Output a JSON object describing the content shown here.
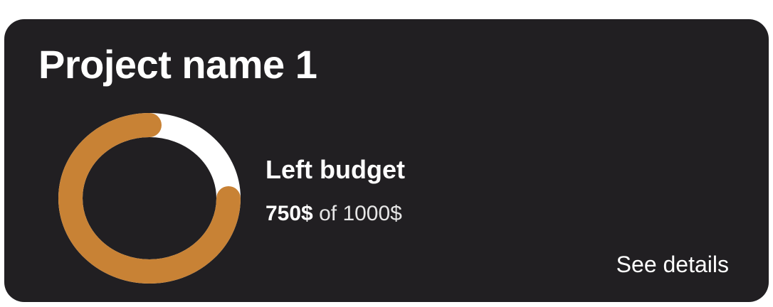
{
  "project": {
    "name": "Project name 1"
  },
  "budget": {
    "title": "Left budget",
    "spent_label": "750$",
    "of_label": " of 1000$",
    "spent": 750,
    "total": 1000
  },
  "actions": {
    "see_details_label": "See details"
  },
  "colors": {
    "card_bg": "#211f22",
    "ring_progress": "#c88235",
    "ring_track": "#ffffff",
    "text": "#ffffff"
  }
}
